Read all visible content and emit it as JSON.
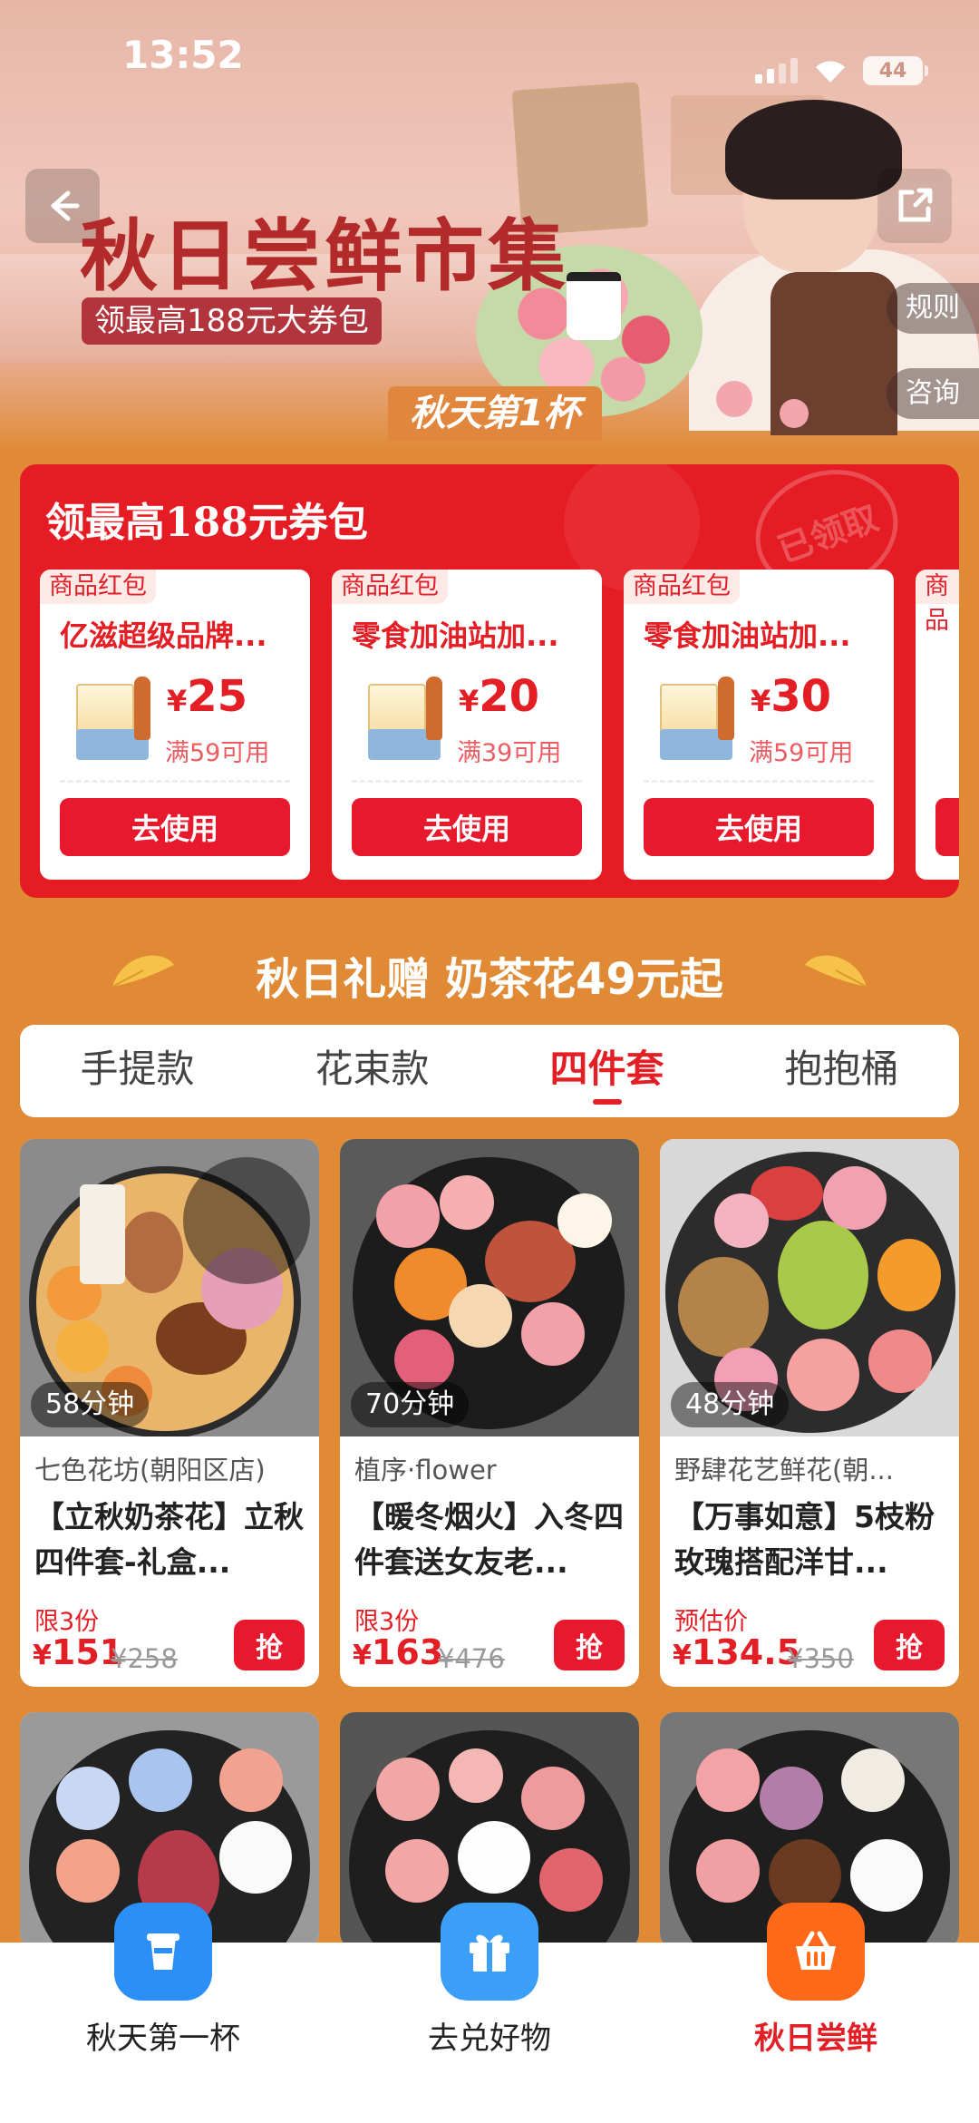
{
  "status_bar": {
    "time": "13:52",
    "battery": "44"
  },
  "hero": {
    "title": "秋日尝鲜市集",
    "subtitle": "领最高188元大券包",
    "badge": "秋天第1杯",
    "rules": "规则",
    "consult": "咨询"
  },
  "coupon_panel": {
    "title": "领最高188元券包",
    "stamp": "已领取",
    "coupons": [
      {
        "tag": "商品红包",
        "name": "亿滋超级品牌...",
        "currency": "¥",
        "amount": "25",
        "condition": "满59可用",
        "button": "去使用"
      },
      {
        "tag": "商品红包",
        "name": "零食加油站加...",
        "currency": "¥",
        "amount": "20",
        "condition": "满39可用",
        "button": "去使用"
      },
      {
        "tag": "商品红包",
        "name": "零食加油站加...",
        "currency": "¥",
        "amount": "30",
        "condition": "满59可用",
        "button": "去使用"
      },
      {
        "tag": "商品"
      }
    ]
  },
  "section": {
    "heading": "秋日礼赠 奶茶花49元起"
  },
  "tabs": [
    "手提款",
    "花束款",
    "四件套",
    "抱抱桶"
  ],
  "active_tab": "四件套",
  "products": [
    {
      "time": "58分钟",
      "shop": "七色花坊(朝阳区店)",
      "title": "【立秋奶茶花】立秋四件套-礼盒...",
      "limit": "限3份",
      "currency": "¥",
      "price": "151",
      "original": "¥258",
      "button": "抢"
    },
    {
      "time": "70分钟",
      "shop": "植序·flower",
      "title": "【暖冬烟火】入冬四件套送女友老...",
      "limit": "限3份",
      "currency": "¥",
      "price": "163",
      "original": "¥476",
      "button": "抢"
    },
    {
      "time": "48分钟",
      "shop": "野肆花艺鲜花(朝...",
      "title": "【万事如意】5枝粉玫瑰搭配洋甘...",
      "limit": "预估价",
      "currency": "¥",
      "price": "134.5",
      "original": "¥350",
      "button": "抢"
    }
  ],
  "bottom_nav": [
    {
      "label": "秋天第一杯",
      "icon": "cup-icon",
      "color": "#2c8ff5"
    },
    {
      "label": "去兑好物",
      "icon": "gift-icon",
      "color": "#3b9ef7"
    },
    {
      "label": "秋日尝鲜",
      "icon": "basket-icon",
      "color": "#ff6a1a"
    }
  ],
  "colors": {
    "accent": "#e31e25",
    "background": "#e08a36"
  }
}
